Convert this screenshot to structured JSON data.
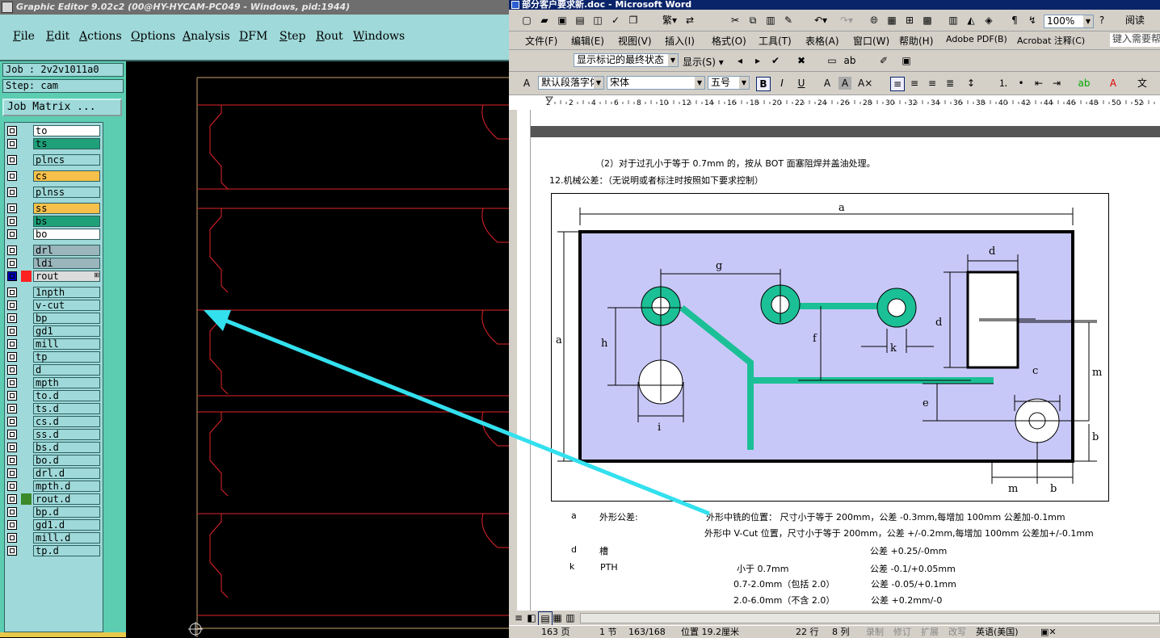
{
  "ge": {
    "title": "Graphic Editor 9.02c2 (00@HY-HYCAM-PC049 - Windows, pid:1944)",
    "menu": [
      "File",
      "Edit",
      "Actions",
      "Options",
      "Analysis",
      "DFM",
      "Step",
      "Rout",
      "Windows"
    ],
    "job_label": "Job : 2v2v1011a0",
    "step_label": "Step: cam",
    "job_matrix_button": "Job Matrix ...",
    "layers": [
      {
        "name": "to",
        "color": "#ffffff",
        "chk": "#ffffff"
      },
      {
        "name": "ts",
        "color": "#1ea079",
        "chk": "#ffffff"
      },
      {
        "name": "plncs",
        "color": "#9fd9d9",
        "chk": "#ffffff"
      },
      {
        "name": "cs",
        "color": "#f6c04a",
        "chk": "#ffffff"
      },
      {
        "name": "plnss",
        "color": "#9fd9d9",
        "chk": "#ffffff"
      },
      {
        "name": "ss",
        "color": "#f6c04a",
        "chk": "#ffffff"
      },
      {
        "name": "bs",
        "color": "#1ea079",
        "chk": "#ffffff"
      },
      {
        "name": "bo",
        "color": "#ffffff",
        "chk": "#ffffff"
      },
      {
        "name": "drl",
        "color": "#9ab5bc",
        "chk": "#ffffff"
      },
      {
        "name": "ldi",
        "color": "#9ab5bc",
        "chk": "#ffffff"
      },
      {
        "name": "rout",
        "color": "#dcdcdc",
        "chk": "#ffffff",
        "active": true
      },
      {
        "name": "1npth",
        "color": "#9fd9d9",
        "chk": "#ffffff"
      },
      {
        "name": "v-cut",
        "color": "#9fd9d9",
        "chk": "#ffffff"
      },
      {
        "name": "bp",
        "color": "#9fd9d9",
        "chk": "#ffffff"
      },
      {
        "name": "gd1",
        "color": "#9fd9d9",
        "chk": "#ffffff"
      },
      {
        "name": "mill",
        "color": "#9fd9d9",
        "chk": "#ffffff"
      },
      {
        "name": "tp",
        "color": "#9fd9d9",
        "chk": "#ffffff"
      },
      {
        "name": "d",
        "color": "#9fd9d9",
        "chk": "#ffffff"
      },
      {
        "name": "mpth",
        "color": "#9fd9d9",
        "chk": "#ffffff"
      },
      {
        "name": "to.d",
        "color": "#9fd9d9",
        "chk": "#ffffff"
      },
      {
        "name": "ts.d",
        "color": "#9fd9d9",
        "chk": "#ffffff"
      },
      {
        "name": "cs.d",
        "color": "#9fd9d9",
        "chk": "#ffffff"
      },
      {
        "name": "ss.d",
        "color": "#9fd9d9",
        "chk": "#ffffff"
      },
      {
        "name": "bs.d",
        "color": "#9fd9d9",
        "chk": "#ffffff"
      },
      {
        "name": "bo.d",
        "color": "#9fd9d9",
        "chk": "#ffffff"
      },
      {
        "name": "drl.d",
        "color": "#9fd9d9",
        "chk": "#ffffff"
      },
      {
        "name": "mpth.d",
        "color": "#9fd9d9",
        "chk": "#ffffff"
      },
      {
        "name": "rout.d",
        "color": "#9fd9d9",
        "chk": "#3a8a2a"
      },
      {
        "name": "bp.d",
        "color": "#9fd9d9",
        "chk": "#ffffff"
      },
      {
        "name": "gd1.d",
        "color": "#9fd9d9",
        "chk": "#ffffff"
      },
      {
        "name": "mill.d",
        "color": "#9fd9d9",
        "chk": "#ffffff"
      },
      {
        "name": "tp.d",
        "color": "#9fd9d9",
        "chk": "#ffffff"
      }
    ],
    "canvas_line_color": "#e0242a",
    "canvas_frame_color": "#c9a36a"
  },
  "word": {
    "title": "部分客户要求新.doc - Microsoft Word",
    "menu": [
      "文件(F)",
      "编辑(E)",
      "视图(V)",
      "插入(I)",
      "格式(O)",
      "工具(T)",
      "表格(A)",
      "窗口(W)",
      "帮助(H)",
      "Adobe PDF(B)",
      "Acrobat 注释(C)"
    ],
    "help_box": "键入需要帮",
    "zoom": "100%",
    "read_btn": "阅读",
    "review_combo": "显示标记的最终状态",
    "show_btn": "显示(S)",
    "style_combo": "默认段落字体",
    "font_combo": "宋体",
    "size_combo": "五号",
    "ruler_marks": [
      "2",
      "2",
      "4",
      "6",
      "8",
      "10",
      "12",
      "14",
      "16",
      "18",
      "20",
      "22",
      "24",
      "26",
      "28",
      "30",
      "32",
      "34",
      "36",
      "38",
      "40",
      "42",
      "44",
      "46",
      "48",
      "50",
      "52"
    ],
    "doc": {
      "line1": "（2）对于过孔小于等于 0.7mm 的，按从 BOT 面塞阻焊并盖油处理。",
      "line2": "12.机械公差：（无说明或者标注时按照如下要求控制）",
      "labels": {
        "a_top": "a",
        "a_left": "a",
        "g": "g",
        "d_top": "d",
        "d_side": "d",
        "h": "h",
        "f": "f",
        "k": "k",
        "m_side": "m",
        "c": "c",
        "e": "e",
        "i": "i",
        "b_side": "b",
        "m_bottom": "m",
        "b_bottom": "b"
      },
      "rows": [
        {
          "key": "a",
          "name": "外形公差:",
          "desc": "外形中铣的位置：  尺寸小于等于 200mm，公差 -0.3mm,每增加 100mm 公差加-0.1mm"
        },
        {
          "key": "",
          "name": "",
          "desc": "外形中 V-Cut 位置，尺寸小于等于 200mm，公差 +/-0.2mm,每增加 100mm 公差加+/-0.1mm"
        },
        {
          "key": "d",
          "name": "槽",
          "tol": "公差 +0.25/-0mm"
        },
        {
          "key": "k",
          "name": "PTH",
          "range": "小于 0.7mm",
          "tol": "公差 -0.1/+0.05mm"
        },
        {
          "key": "",
          "name": "",
          "range": "0.7-2.0mm（包括 2.0）",
          "tol": "公差  -0.05/+0.1mm"
        },
        {
          "key": "",
          "name": "",
          "range": "2.0-6.0mm（不含 2.0）",
          "tol": "公差 +0.2mm/-0"
        }
      ]
    },
    "status": {
      "page": "163 页",
      "section": "1 节",
      "pages": "163/168",
      "position": "位置 19.2厘米",
      "line": "22 行",
      "col": "8 列",
      "rec": "录制",
      "trk": "修订",
      "ext": "扩展",
      "ovr": "改写",
      "lang": "英语(美国)"
    },
    "diagram_colors": {
      "board": "#c8c8f8",
      "trace": "#1cc096",
      "border": "#000000"
    }
  },
  "annotation": {
    "arrow_color": "#33e0ee"
  }
}
